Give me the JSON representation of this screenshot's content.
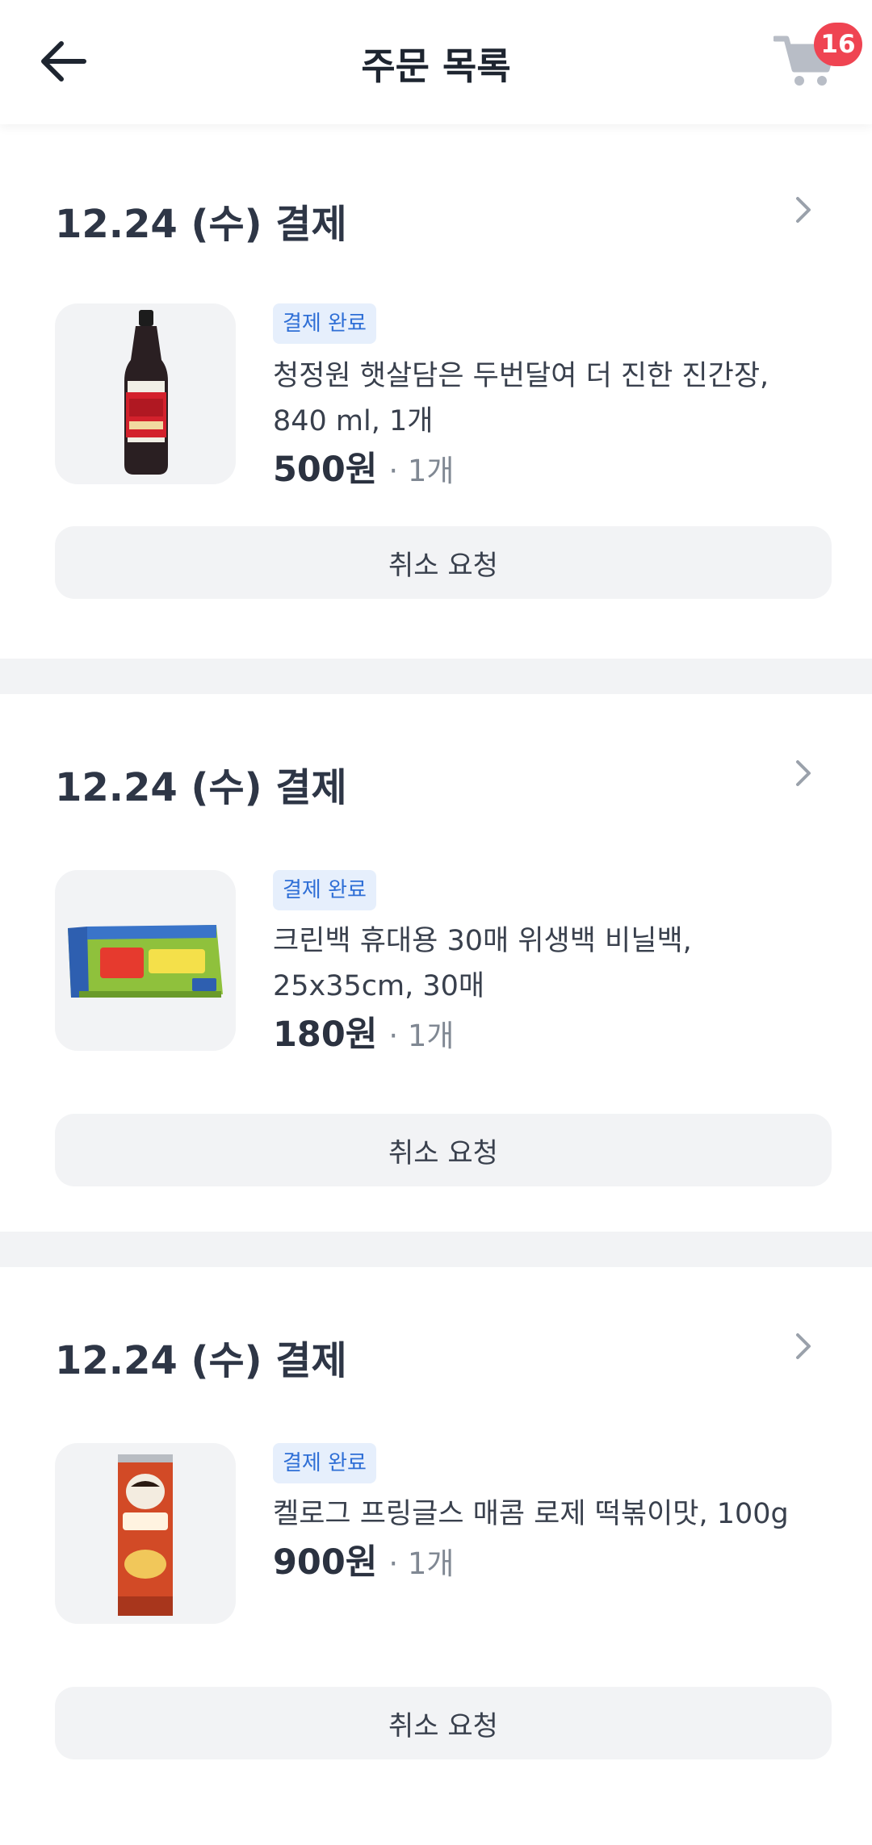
{
  "header": {
    "title": "주문 목록",
    "cart_count": "16"
  },
  "orders": [
    {
      "date": "12.24 (수) 결제",
      "status": "결제 완료",
      "product_name": "청정원 햇살담은 두번달여 더 진한 진간장, 840 ml, 1개",
      "price": "500원",
      "quantity": "· 1개",
      "cancel_label": "취소 요청",
      "image": "soy-sauce-bottle"
    },
    {
      "date": "12.24 (수) 결제",
      "status": "결제 완료",
      "product_name": "크린백 휴대용 30매 위생백 비닐백, 25x35cm, 30매",
      "price": "180원",
      "quantity": "· 1개",
      "cancel_label": "취소 요청",
      "image": "clean-bag-box"
    },
    {
      "date": "12.24 (수) 결제",
      "status": "결제 완료",
      "product_name": "켈로그 프링글스 매콤 로제 떡볶이맛, 100g",
      "price": "900원",
      "quantity": "· 1개",
      "cancel_label": "취소 요청",
      "image": "pringles-can"
    }
  ],
  "colors": {
    "badge": "#ef4452",
    "status_bg": "#e6effc",
    "status_text": "#2f6fd6",
    "divider": "#f2f3f5"
  },
  "icons": [
    "back-arrow-icon",
    "cart-icon",
    "chevron-right-icon"
  ]
}
